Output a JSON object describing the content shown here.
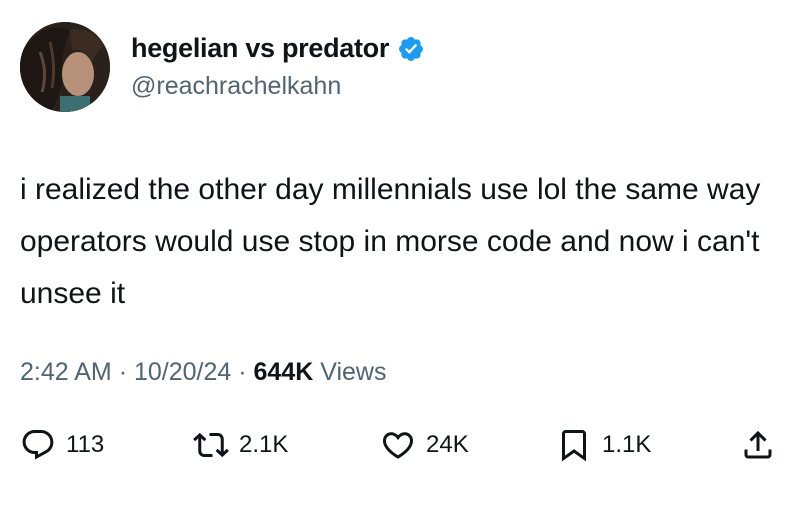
{
  "author": {
    "display_name": "hegelian vs predator",
    "handle": "@reachrachelkahn",
    "verified": true,
    "avatar_icon": "avatar",
    "badge_color": "#1d9bf0"
  },
  "tweet": {
    "text": "i realized the other day millennials use lol the same way operators would use stop in morse code and now i can't unsee it"
  },
  "meta": {
    "time": "2:42 AM",
    "separator": "·",
    "date": "10/20/24",
    "views_count": "644K",
    "views_label": "Views"
  },
  "actions": {
    "reply": {
      "icon": "reply-icon",
      "count": "113"
    },
    "retweet": {
      "icon": "retweet-icon",
      "count": "2.1K"
    },
    "like": {
      "icon": "like-icon",
      "count": "24K"
    },
    "bookmark": {
      "icon": "bookmark-icon",
      "count": "1.1K"
    },
    "share": {
      "icon": "share-icon"
    }
  }
}
